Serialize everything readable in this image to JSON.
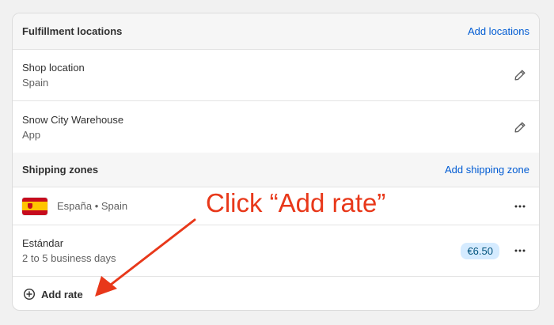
{
  "fulfillment": {
    "title": "Fulfillment locations",
    "add_link": "Add locations",
    "locations": [
      {
        "name": "Shop location",
        "sub": "Spain"
      },
      {
        "name": "Snow City Warehouse",
        "sub": "App"
      }
    ]
  },
  "zones": {
    "title": "Shipping zones",
    "add_link": "Add shipping zone",
    "zone": {
      "name": "España • Spain",
      "flag": "spain-flag"
    },
    "rate": {
      "name": "Estándar",
      "sub": "2 to 5 business days",
      "price": "€6.50"
    },
    "add_rate_label": "Add rate"
  },
  "annotation": {
    "text": "Click “Add rate”",
    "color": "#e8381a"
  },
  "colors": {
    "link": "#005bd3",
    "badge_bg": "#d5ebff",
    "badge_text": "#00527c"
  }
}
